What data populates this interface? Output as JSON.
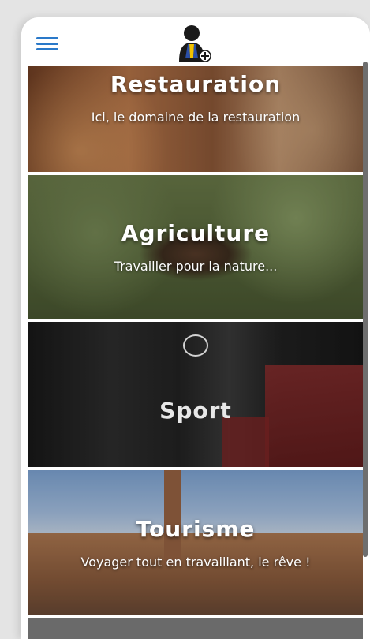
{
  "topbar": {
    "menu_icon": "hamburger-menu-icon",
    "logo_icon": "worker-avatar-logo-icon"
  },
  "colors": {
    "accent": "#2a79c9",
    "background": "#ffffff"
  },
  "cards": [
    {
      "title": "Restauration",
      "subtitle": "Ici, le domaine de la restauration"
    },
    {
      "title": "Agriculture",
      "subtitle": "Travailler pour la nature..."
    },
    {
      "title": "Sport",
      "subtitle": ""
    },
    {
      "title": "Tourisme",
      "subtitle": "Voyager tout en travaillant, le rêve !"
    }
  ]
}
